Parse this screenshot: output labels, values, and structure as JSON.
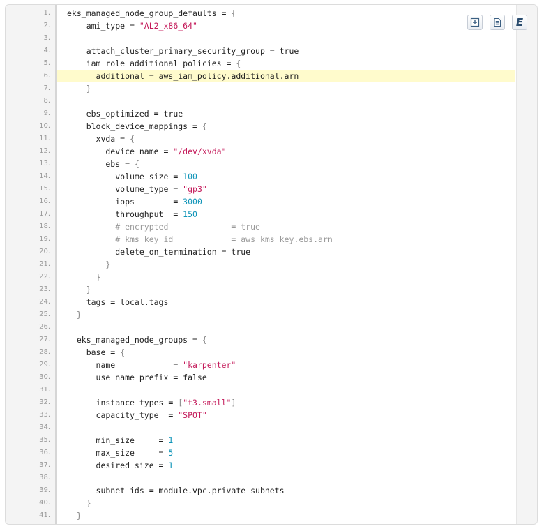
{
  "toolbar": {
    "buttons": [
      {
        "name": "expand-source-button",
        "icon": "expand-icon"
      },
      {
        "name": "view-source-button",
        "icon": "document-icon"
      },
      {
        "name": "evernote-button",
        "icon": "evernote-icon",
        "label": "E"
      }
    ]
  },
  "code": {
    "highlighted_line": 6,
    "lines": [
      {
        "n": "1.",
        "t": [
          [
            "plain",
            "eks_managed_node_group_defaults = "
          ],
          [
            "punct",
            "{"
          ]
        ]
      },
      {
        "n": "2.",
        "t": [
          [
            "plain",
            "    ami_type = "
          ],
          [
            "string",
            "\"AL2_x86_64\""
          ]
        ]
      },
      {
        "n": "3.",
        "t": []
      },
      {
        "n": "4.",
        "t": [
          [
            "plain",
            "    attach_cluster_primary_security_group = true"
          ]
        ]
      },
      {
        "n": "5.",
        "t": [
          [
            "plain",
            "    iam_role_additional_policies = "
          ],
          [
            "punct",
            "{"
          ]
        ]
      },
      {
        "n": "6.",
        "t": [
          [
            "plain",
            "      additional = aws_iam_policy.additional.arn"
          ]
        ]
      },
      {
        "n": "7.",
        "t": [
          [
            "punct",
            "    }"
          ]
        ]
      },
      {
        "n": "8.",
        "t": []
      },
      {
        "n": "9.",
        "t": [
          [
            "plain",
            "    ebs_optimized = true"
          ]
        ]
      },
      {
        "n": "10.",
        "t": [
          [
            "plain",
            "    block_device_mappings = "
          ],
          [
            "punct",
            "{"
          ]
        ]
      },
      {
        "n": "11.",
        "t": [
          [
            "plain",
            "      xvda = "
          ],
          [
            "punct",
            "{"
          ]
        ]
      },
      {
        "n": "12.",
        "t": [
          [
            "plain",
            "        device_name = "
          ],
          [
            "string",
            "\"/dev/xvda\""
          ]
        ]
      },
      {
        "n": "13.",
        "t": [
          [
            "plain",
            "        ebs = "
          ],
          [
            "punct",
            "{"
          ]
        ]
      },
      {
        "n": "14.",
        "t": [
          [
            "plain",
            "          volume_size = "
          ],
          [
            "number",
            "100"
          ]
        ]
      },
      {
        "n": "15.",
        "t": [
          [
            "plain",
            "          volume_type = "
          ],
          [
            "string",
            "\"gp3\""
          ]
        ]
      },
      {
        "n": "16.",
        "t": [
          [
            "plain",
            "          iops        = "
          ],
          [
            "number",
            "3000"
          ]
        ]
      },
      {
        "n": "17.",
        "t": [
          [
            "plain",
            "          throughput  = "
          ],
          [
            "number",
            "150"
          ]
        ]
      },
      {
        "n": "18.",
        "t": [
          [
            "comment",
            "          # encrypted             = true"
          ]
        ]
      },
      {
        "n": "19.",
        "t": [
          [
            "comment",
            "          # kms_key_id            = aws_kms_key.ebs.arn"
          ]
        ]
      },
      {
        "n": "20.",
        "t": [
          [
            "plain",
            "          delete_on_termination = true"
          ]
        ]
      },
      {
        "n": "21.",
        "t": [
          [
            "punct",
            "        }"
          ]
        ]
      },
      {
        "n": "22.",
        "t": [
          [
            "punct",
            "      }"
          ]
        ]
      },
      {
        "n": "23.",
        "t": [
          [
            "punct",
            "    }"
          ]
        ]
      },
      {
        "n": "24.",
        "t": [
          [
            "plain",
            "    tags = local.tags"
          ]
        ]
      },
      {
        "n": "25.",
        "t": [
          [
            "punct",
            "  }"
          ]
        ]
      },
      {
        "n": "26.",
        "t": []
      },
      {
        "n": "27.",
        "t": [
          [
            "plain",
            "  eks_managed_node_groups = "
          ],
          [
            "punct",
            "{"
          ]
        ]
      },
      {
        "n": "28.",
        "t": [
          [
            "plain",
            "    base = "
          ],
          [
            "punct",
            "{"
          ]
        ]
      },
      {
        "n": "29.",
        "t": [
          [
            "plain",
            "      name            = "
          ],
          [
            "string",
            "\"karpenter\""
          ]
        ]
      },
      {
        "n": "30.",
        "t": [
          [
            "plain",
            "      use_name_prefix = false"
          ]
        ]
      },
      {
        "n": "31.",
        "t": []
      },
      {
        "n": "32.",
        "t": [
          [
            "plain",
            "      instance_types = "
          ],
          [
            "punct",
            "["
          ],
          [
            "string",
            "\"t3.small\""
          ],
          [
            "punct",
            "]"
          ]
        ]
      },
      {
        "n": "33.",
        "t": [
          [
            "plain",
            "      capacity_type  = "
          ],
          [
            "string",
            "\"SPOT\""
          ]
        ]
      },
      {
        "n": "34.",
        "t": []
      },
      {
        "n": "35.",
        "t": [
          [
            "plain",
            "      min_size     = "
          ],
          [
            "number",
            "1"
          ]
        ]
      },
      {
        "n": "36.",
        "t": [
          [
            "plain",
            "      max_size     = "
          ],
          [
            "number",
            "5"
          ]
        ]
      },
      {
        "n": "37.",
        "t": [
          [
            "plain",
            "      desired_size = "
          ],
          [
            "number",
            "1"
          ]
        ]
      },
      {
        "n": "38.",
        "t": []
      },
      {
        "n": "39.",
        "t": [
          [
            "plain",
            "      subnet_ids = module.vpc.private_subnets"
          ]
        ]
      },
      {
        "n": "40.",
        "t": [
          [
            "punct",
            "    }"
          ]
        ]
      },
      {
        "n": "41.",
        "t": [
          [
            "punct",
            "  }"
          ]
        ]
      }
    ]
  }
}
